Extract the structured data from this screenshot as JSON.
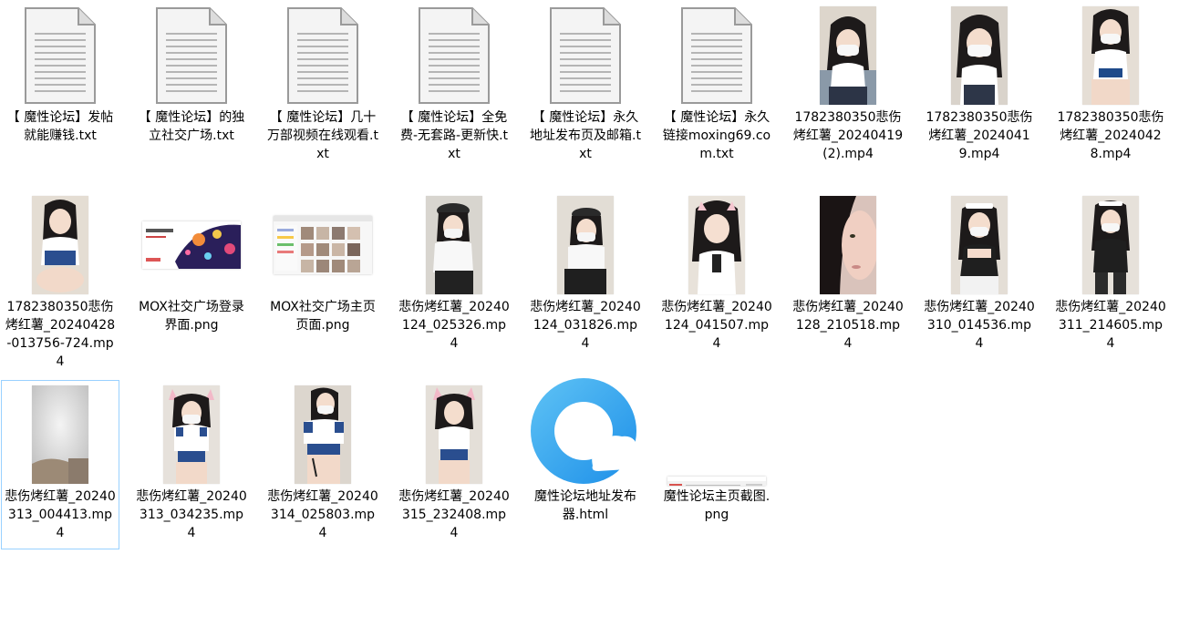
{
  "files": [
    {
      "name": "【 魔性论坛】发帖就能赚钱.txt",
      "kind": "txt",
      "icon": "text-document-icon"
    },
    {
      "name": "【 魔性论坛】的独立社交广场.txt",
      "kind": "txt",
      "icon": "text-document-icon"
    },
    {
      "name": "【 魔性论坛】几十万部视频在线观看.txt",
      "kind": "txt",
      "icon": "text-document-icon"
    },
    {
      "name": "【 魔性论坛】全免费-无套路-更新快.txt",
      "kind": "txt",
      "icon": "text-document-icon"
    },
    {
      "name": "【 魔性论坛】永久地址发布页及邮箱.txt",
      "kind": "txt",
      "icon": "text-document-icon"
    },
    {
      "name": "【 魔性论坛】永久链接moxing69.com.txt",
      "kind": "txt",
      "icon": "text-document-icon"
    },
    {
      "name": "1782380350悲伤烤红薯_20240419 (2).mp4",
      "kind": "mp4",
      "icon": "video-thumbnail"
    },
    {
      "name": "1782380350悲伤烤红薯_20240419.mp4",
      "kind": "mp4",
      "icon": "video-thumbnail"
    },
    {
      "name": "1782380350悲伤烤红薯_20240428.mp4",
      "kind": "mp4",
      "icon": "video-thumbnail"
    },
    {
      "name": "1782380350悲伤烤红薯_20240428-013756-724.mp4",
      "kind": "mp4",
      "icon": "video-thumbnail"
    },
    {
      "name": "MOX社交广场登录界面.png",
      "kind": "png",
      "icon": "image-thumbnail"
    },
    {
      "name": "MOX社交广场主页页面.png",
      "kind": "png",
      "icon": "image-thumbnail"
    },
    {
      "name": "悲伤烤红薯_20240124_025326.mp4",
      "kind": "mp4",
      "icon": "video-thumbnail"
    },
    {
      "name": "悲伤烤红薯_20240124_031826.mp4",
      "kind": "mp4",
      "icon": "video-thumbnail"
    },
    {
      "name": "悲伤烤红薯_20240124_041507.mp4",
      "kind": "mp4",
      "icon": "video-thumbnail"
    },
    {
      "name": "悲伤烤红薯_20240128_210518.mp4",
      "kind": "mp4",
      "icon": "video-thumbnail"
    },
    {
      "name": "悲伤烤红薯_20240310_014536.mp4",
      "kind": "mp4",
      "icon": "video-thumbnail"
    },
    {
      "name": "悲伤烤红薯_20240311_214605.mp4",
      "kind": "mp4",
      "icon": "video-thumbnail"
    },
    {
      "name": "悲伤烤红薯_20240313_004413.mp4",
      "kind": "mp4",
      "icon": "video-thumbnail",
      "selected": true
    },
    {
      "name": "悲伤烤红薯_20240313_034235.mp4",
      "kind": "mp4",
      "icon": "video-thumbnail"
    },
    {
      "name": "悲伤烤红薯_20240314_025803.mp4",
      "kind": "mp4",
      "icon": "video-thumbnail"
    },
    {
      "name": "悲伤烤红薯_20240315_232408.mp4",
      "kind": "mp4",
      "icon": "video-thumbnail"
    },
    {
      "name": "魔性论坛地址发布器.html",
      "kind": "html",
      "icon": "browser-icon"
    },
    {
      "name": "魔性论坛主页截图.png",
      "kind": "png",
      "icon": "image-thumbnail"
    }
  ],
  "colors": {
    "selection_border": "#99d1ff",
    "browser_blue": "#1d8fe8",
    "browser_light_blue": "#5fc3f5"
  }
}
